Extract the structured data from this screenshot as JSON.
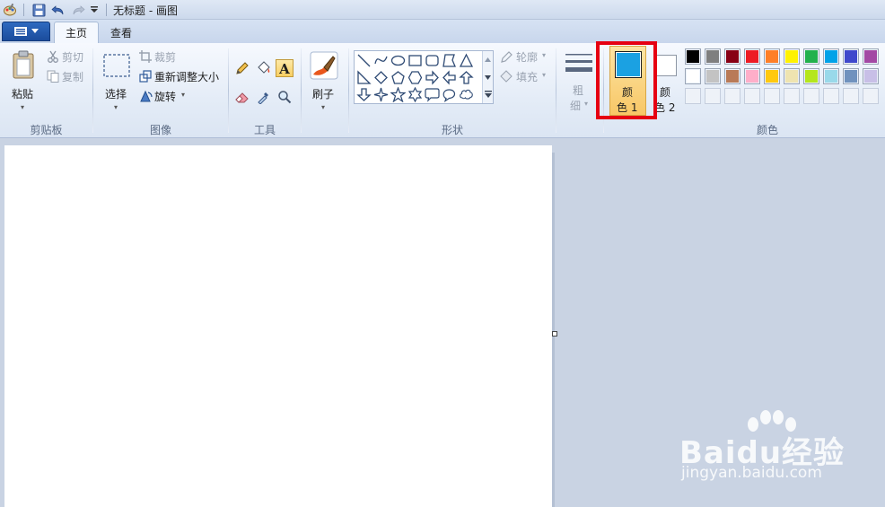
{
  "window": {
    "title": "无标题 - 画图"
  },
  "tabs": [
    {
      "label": "主页",
      "active": true
    },
    {
      "label": "查看",
      "active": false
    }
  ],
  "clipboard": {
    "paste": "粘贴",
    "cut": "剪切",
    "copy": "复制",
    "group": "剪贴板"
  },
  "image": {
    "select": "选择",
    "crop": "裁剪",
    "resize": "重新调整大小",
    "rotate": "旋转",
    "group": "图像"
  },
  "tools": {
    "group": "工具",
    "selected": "text"
  },
  "brushes": {
    "label": "刷子"
  },
  "shapes": {
    "outline": "轮廓",
    "fill": "填充",
    "group": "形状"
  },
  "size": {
    "label_top": "粗",
    "label_bottom": "细"
  },
  "colors": {
    "color1": {
      "label_top": "颜",
      "label_bottom": "色 1",
      "value": "#1ba1e2"
    },
    "color2": {
      "label_top": "颜",
      "label_bottom": "色 2",
      "value": "#ffffff"
    },
    "group": "颜色",
    "palette": [
      [
        "#000000",
        "#7f7f7f",
        "#880015",
        "#ed1c24",
        "#ff7f27",
        "#fff200",
        "#22b14c",
        "#00a2e8",
        "#3f48cc",
        "#a349a4"
      ],
      [
        "#ffffff",
        "#c3c3c3",
        "#b97a57",
        "#ffaec9",
        "#ffc90e",
        "#efe4b0",
        "#b5e61d",
        "#99d9ea",
        "#7092be",
        "#c8bfe7"
      ],
      [
        "",
        "",
        "",
        "",
        "",
        "",
        "",
        "",
        "",
        ""
      ]
    ]
  },
  "watermark": {
    "brand": "Baidu经验",
    "url": "jingyan.baidu.com"
  }
}
